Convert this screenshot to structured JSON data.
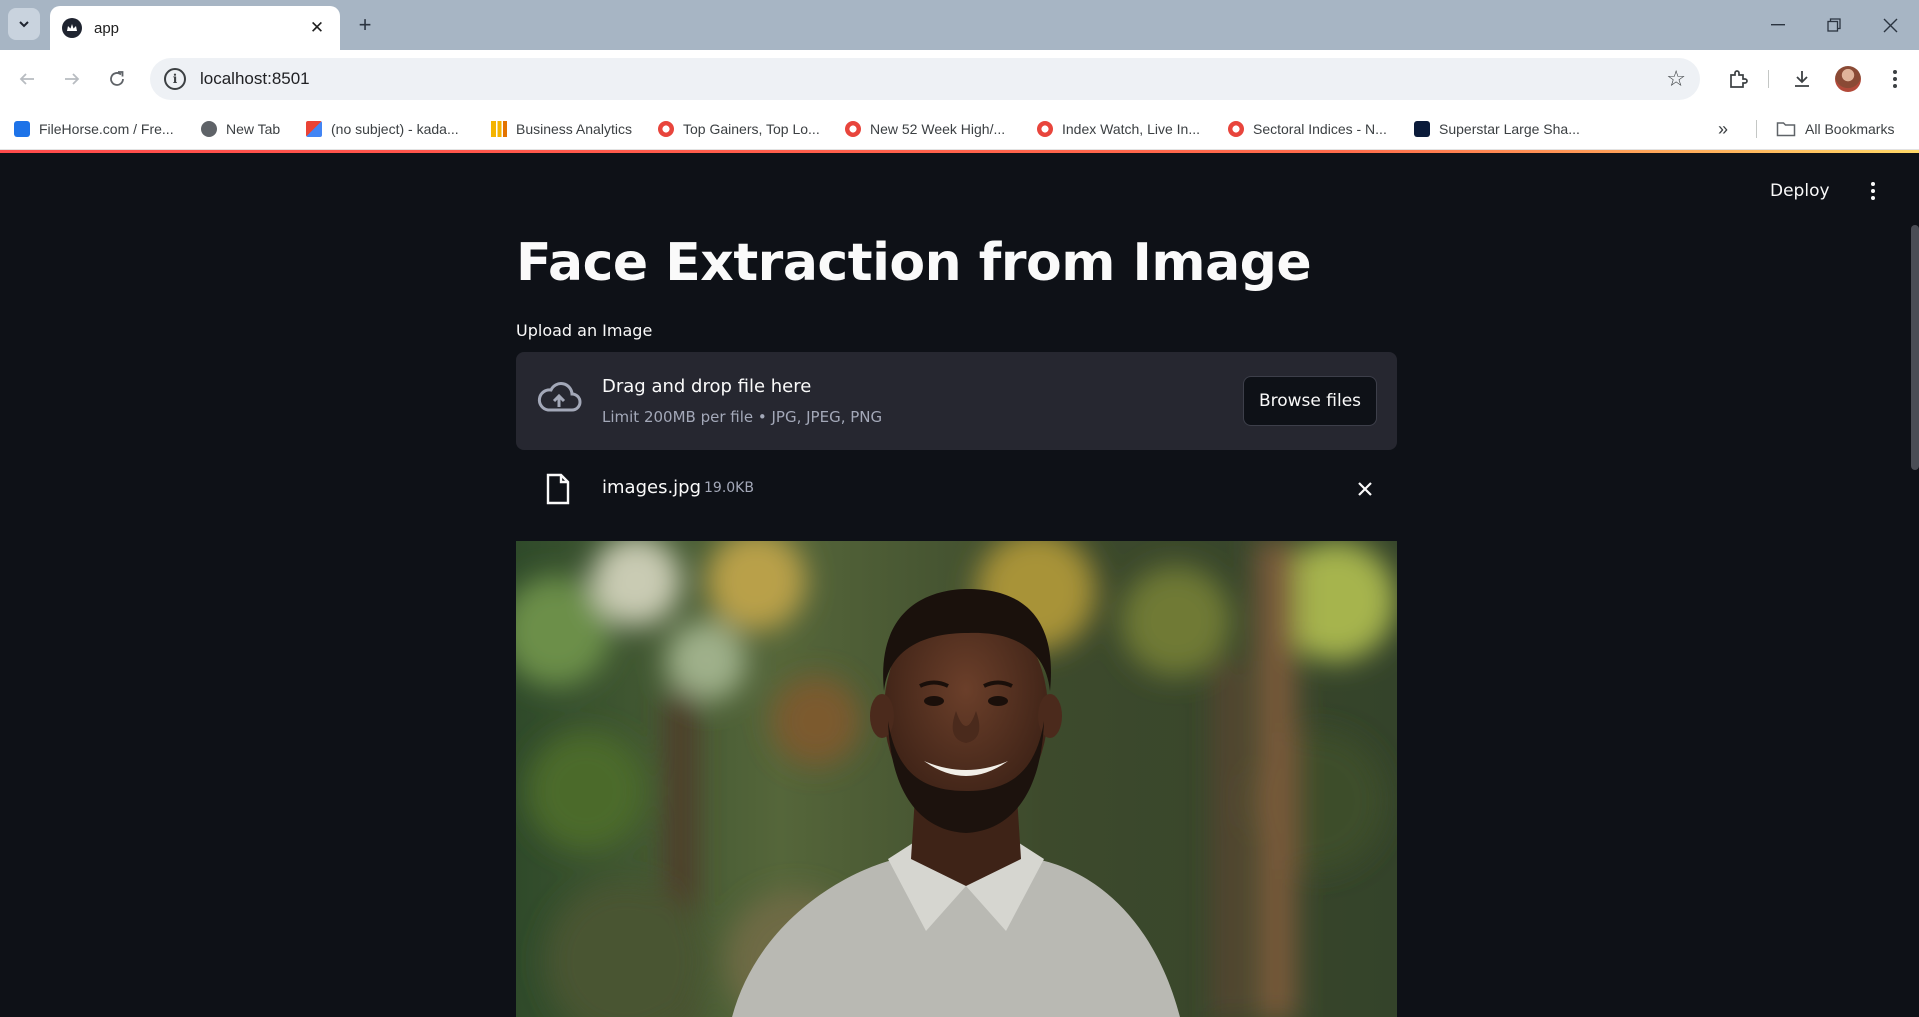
{
  "browser": {
    "tab_title": "app",
    "url": "localhost:8501",
    "bookmarks": [
      {
        "label": "FileHorse.com / Fre...",
        "icon": "filehorse-icon",
        "color": "#1e73e8"
      },
      {
        "label": "New Tab",
        "icon": "globe-icon",
        "color": "#5f6368"
      },
      {
        "label": "(no subject) - kada...",
        "icon": "gmail-icon",
        "color": "#ea4335"
      },
      {
        "label": "Business Analytics",
        "icon": "analytics-icon",
        "color": "#f4b400"
      },
      {
        "label": "Top Gainers, Top Lo...",
        "icon": "moneycontrol-icon",
        "color": "#e8453c"
      },
      {
        "label": "New 52 Week High/...",
        "icon": "moneycontrol-icon",
        "color": "#e8453c"
      },
      {
        "label": "Index Watch, Live In...",
        "icon": "moneycontrol-icon",
        "color": "#e8453c"
      },
      {
        "label": "Sectoral Indices - N...",
        "icon": "moneycontrol-icon",
        "color": "#e8453c"
      },
      {
        "label": "Superstar Large Sha...",
        "icon": "trendlyne-icon",
        "color": "#0b1b3a"
      }
    ],
    "all_bookmarks": "All Bookmarks"
  },
  "app": {
    "deploy_label": "Deploy",
    "title": "Face Extraction from Image",
    "uploader": {
      "label": "Upload an Image",
      "drop_text": "Drag and drop file here",
      "limit_text": "Limit 200MB per file • JPG, JPEG, PNG",
      "browse_label": "Browse files"
    },
    "file": {
      "name": "images.jpg",
      "size": "19.0KB"
    },
    "colors": {
      "background": "#0e1117",
      "dropzone": "#262730",
      "text": "#fafafa",
      "muted": "#a3a8b8",
      "accent": "#ff4b4b"
    }
  }
}
